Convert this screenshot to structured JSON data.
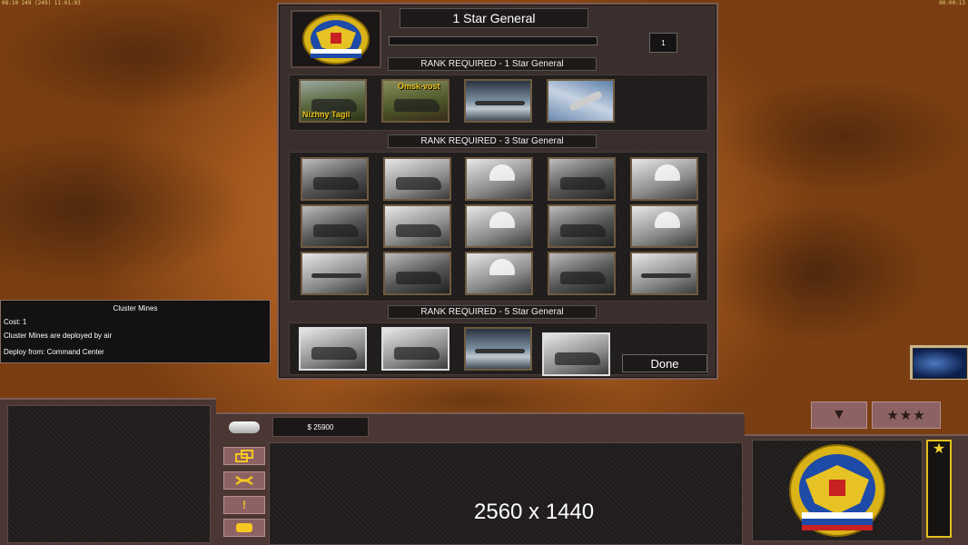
{
  "topbar": {
    "left": "08:10 249 (249) 11:01:03",
    "right": "00:00:13"
  },
  "dialog": {
    "title": "1 Star General",
    "count": "1",
    "emblem": "russian-eagle-emblem",
    "sections": [
      {
        "label": "RANK REQUIRED - 1 Star General",
        "tiles": [
          {
            "name": "tank-nizhny-tagil",
            "caption": "Nizhny Tagil"
          },
          {
            "name": "tank-omsk-vost",
            "caption": "Omsk-vost"
          },
          {
            "name": "fighter-jet"
          },
          {
            "name": "wrench-repair"
          }
        ]
      },
      {
        "label": "RANK REQUIRED - 3 Star General",
        "tiles": [
          {
            "name": "tank-snow"
          },
          {
            "name": "artillery-firing"
          },
          {
            "name": "airdrop-vehicle"
          },
          {
            "name": "explosion-aerial"
          },
          {
            "name": "paratroopers-sky"
          },
          {
            "name": "ghillie-soldier"
          },
          {
            "name": "artillery-battery"
          },
          {
            "name": "airdrop-paratank"
          },
          {
            "name": "soldier-aiming"
          },
          {
            "name": "paratroop-drop"
          },
          {
            "name": "missile-strike"
          },
          {
            "name": "howitzer-battery"
          },
          {
            "name": "para-bmd"
          },
          {
            "name": "cluster-bombs"
          },
          {
            "name": "transport-drop"
          }
        ]
      },
      {
        "label": "RANK REQUIRED - 5 Star General",
        "tiles": [
          {
            "name": "icbm-launcher"
          },
          {
            "name": "topol-missile"
          },
          {
            "name": "submarine"
          },
          {
            "name": "warship"
          }
        ]
      }
    ],
    "done_label": "Done"
  },
  "tooltip": {
    "title": "Cluster Mines",
    "cost": "Cost: 1",
    "description": "Cluster Mines are deployed by air",
    "deploy": "Deploy from: Command Center"
  },
  "hud": {
    "money": "$ 25900",
    "resolution": "2560 x 1440",
    "commands": [
      "structure-icon",
      "wrench-icon",
      "alert-icon",
      "chat-icon"
    ],
    "rank_stars": "★",
    "generals_button": "★★★",
    "down_arrow": "▼"
  }
}
